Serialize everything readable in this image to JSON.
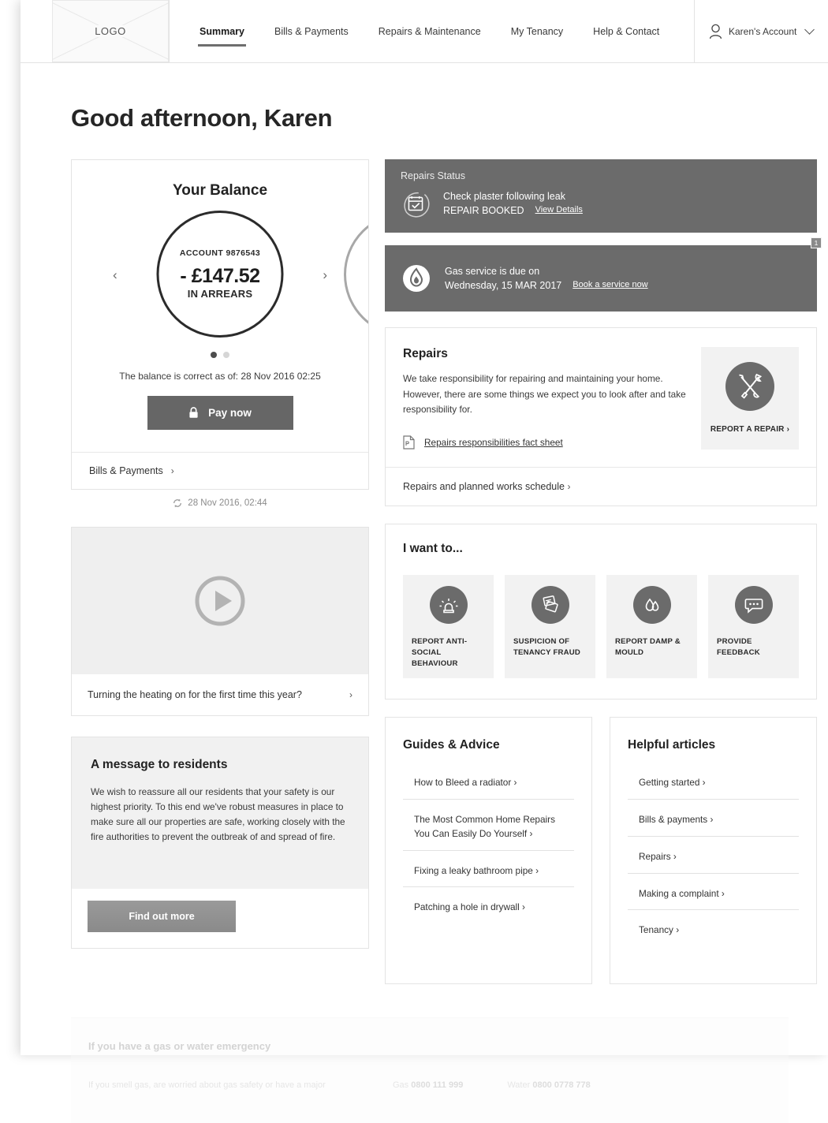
{
  "header": {
    "logo_text": "LOGO",
    "nav": [
      {
        "label": "Summary",
        "active": true
      },
      {
        "label": "Bills & Payments",
        "active": false
      },
      {
        "label": "Repairs & Maintenance",
        "active": false
      },
      {
        "label": "My Tenancy",
        "active": false
      },
      {
        "label": "Help & Contact",
        "active": false
      }
    ],
    "account_label": "Karen's Account",
    "person_icon": "person-icon",
    "chevron_icon": "chevron-down-icon"
  },
  "greeting": "Good afternoon, Karen",
  "balance": {
    "title": "Your Balance",
    "account_label": "ACCOUNT 9876543",
    "amount": "- £147.52",
    "state": "IN ARREARS",
    "prev_arrow": "‹",
    "next_arrow": "›",
    "note": "The balance is correct as of: 28 Nov 2016 02:25",
    "pay_button": "Pay now",
    "lock_icon": "lock-icon",
    "footer_link": "Bills & Payments",
    "refresh_icon": "refresh-icon",
    "refresh_time": "28 Nov 2016, 02:44"
  },
  "video": {
    "play_icon": "play-icon",
    "caption": "Turning the heating on for the first time this year?"
  },
  "message": {
    "title": "A message to residents",
    "body": "We wish to reassure all our residents that your safety is our highest priority. To this end we've robust measures in place to make sure all our properties are safe, working closely with the fire authorities to prevent the outbreak of and spread of fire.",
    "button": "Find out more"
  },
  "repairs_status": {
    "label": "Repairs Status",
    "icon": "calendar-check-icon",
    "line1": "Check plaster following leak",
    "line2": "REPAIR BOOKED",
    "link": "View Details"
  },
  "gas_service": {
    "icon": "flame-icon",
    "line1": "Gas service is due on",
    "line2": "Wednesday, 15 MAR 2017",
    "link": "Book a service now",
    "badge": "1"
  },
  "repairs": {
    "title": "Repairs",
    "body": "We take responsibility for repairing and maintaining your home. However, there are some things we expect you to look after and take responsibility for.",
    "pdf_icon": "pdf-icon",
    "fact_sheet": "Repairs responsibilities fact sheet",
    "tile_icon": "tools-icon",
    "tile_label": "REPORT A REPAIR",
    "footer_link": "Repairs and planned works schedule"
  },
  "i_want_to": {
    "title": "I want to...",
    "tiles": [
      {
        "label": "REPORT ANTI-SOCIAL BEHAVIOUR",
        "icon": "siren-icon"
      },
      {
        "label": "SUSPICION OF TENANCY FRAUD",
        "icon": "documents-icon"
      },
      {
        "label": "REPORT DAMP & MOULD",
        "icon": "water-drop-icon"
      },
      {
        "label": "PROVIDE FEEDBACK",
        "icon": "speech-bubble-icon"
      }
    ]
  },
  "guides": {
    "title": "Guides & Advice",
    "items": [
      "How to Bleed a radiator",
      "The Most Common Home Repairs You Can Easily Do Yourself",
      "Fixing a leaky bathroom pipe",
      "Patching a hole in drywall"
    ]
  },
  "articles": {
    "title": "Helpful articles",
    "items": [
      "Getting started",
      "Bills & payments",
      "Repairs",
      "Making a complaint",
      "Tenancy"
    ]
  },
  "footer": {
    "title": "If you have a gas or water emergency",
    "description": "If you smell gas, are worried about gas safety or have a major",
    "gas_label": "Gas",
    "gas_number": "0800 111 999",
    "water_label": "Water",
    "water_number": "0800 0778 778"
  },
  "colors": {
    "banner_gray": "#6b6b6b",
    "button_gray": "#666666",
    "tile_bg": "#f2f2f2",
    "text_dark": "#222222"
  }
}
